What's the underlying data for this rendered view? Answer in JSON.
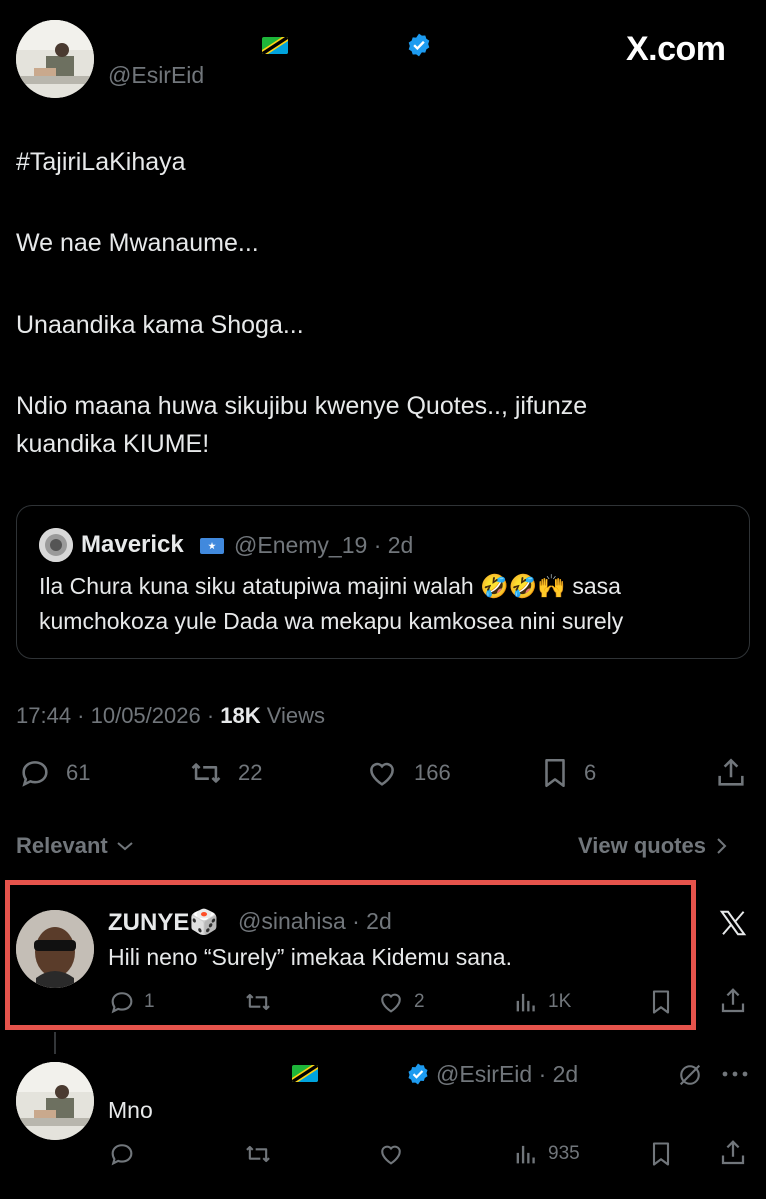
{
  "header": {
    "handle": "@EsirEid",
    "site_logo": "X.com"
  },
  "tweet": {
    "hashtag": "#TajiriLaKihaya",
    "lines": [
      "We nae Mwanaume...",
      "Unaandika kama Shoga...",
      "Ndio maana huwa sikujibu kwenye Quotes.., jifunze",
      "kuandika KIUME!"
    ],
    "quote": {
      "name": "Maverick",
      "handle_time": "@Enemy_19 · 2d",
      "text_line1": "Ila Chura kuna siku atatupiwa majini walah 🤣🤣🙌 sasa",
      "text_line2": "kumchokoza yule Dada wa mekapu kamkosea nini surely"
    },
    "meta": {
      "time_date": "17:44 · 10/05/2026 · ",
      "views_count": "18K",
      "views_label": " Views"
    },
    "actions": {
      "replies": "61",
      "reposts": "22",
      "likes": "166",
      "bookmarks": "6"
    }
  },
  "sort": {
    "relevant_label": "Relevant",
    "view_quotes_label": "View quotes"
  },
  "reply1": {
    "name": "ZUNYE🎲",
    "handle_time": "@sinahisa · 2d",
    "text": "Hili neno “Surely” imekaa Kidemu sana.",
    "replies": "1",
    "likes": "2",
    "views": "1K"
  },
  "reply2": {
    "handle_time": "@EsirEid · 2d",
    "text": "Mno",
    "views": "935"
  },
  "colors": {
    "accent": "#1d9bf0",
    "highlight": "#e5534b",
    "background": "#000000"
  }
}
